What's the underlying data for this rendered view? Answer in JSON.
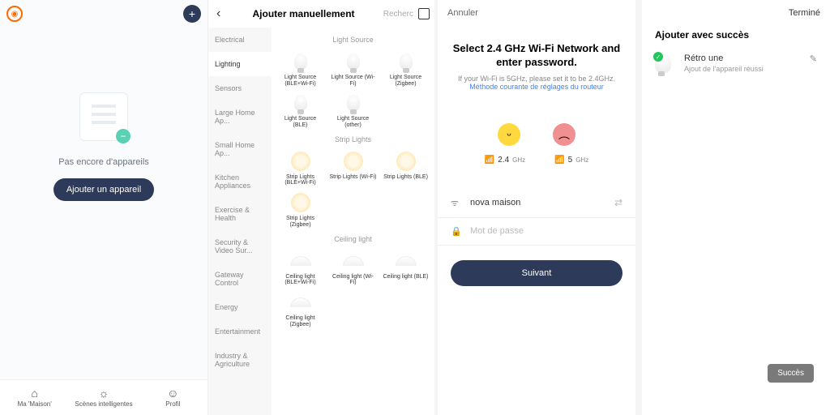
{
  "pane1": {
    "empty_msg": "Pas encore d'appareils",
    "add_btn": "Ajouter un appareil",
    "nav": [
      {
        "icon": "⌂",
        "label": "Ma 'Maison'"
      },
      {
        "icon": "☼",
        "label": "Scènes intelligentes"
      },
      {
        "icon": "☺",
        "label": "Profil"
      }
    ]
  },
  "pane2": {
    "title": "Ajouter manuellement",
    "search_hint": "Recherc",
    "categories": [
      "Electrical",
      "Lighting",
      "Sensors",
      "Large Home Ap...",
      "Small Home Ap...",
      "Kitchen Appliances",
      "Exercise & Health",
      "Security & Video Sur...",
      "Gateway Control",
      "Energy",
      "Entertainment",
      "Industry & Agriculture"
    ],
    "active_category": 1,
    "sections": [
      {
        "title": "Light Source",
        "type": "bulb",
        "items": [
          "Light Source (BLE+Wi-Fi)",
          "Light Source (Wi-Fi)",
          "Light Source (Zigbee)",
          "Light Source (BLE)",
          "Light Source (other)"
        ]
      },
      {
        "title": "Strip Lights",
        "type": "strip",
        "items": [
          "Strip Lights (BLE+Wi-Fi)",
          "Strip Lights (Wi-Fi)",
          "Strip Lights (BLE)",
          "Strip Lights (Zigbee)"
        ]
      },
      {
        "title": "Ceiling light",
        "type": "ceil",
        "items": [
          "Ceiling light (BLE+Wi-Fi)",
          "Ceiling light (Wi-Fi)",
          "Ceiling light (BLE)",
          "Ceiling light (Zigbee)"
        ]
      }
    ]
  },
  "pane3": {
    "cancel": "Annuler",
    "title": "Select 2.4 GHz Wi-Fi Network and enter password.",
    "sub_pre": "If your Wi-Fi is 5GHz, please set it to be 2.4GHz. ",
    "sub_link": "Méthode courante de réglages du routeur",
    "freq24": "2.4",
    "ghz": "GHz",
    "freq5": "5",
    "ssid": "nova maison",
    "pw_placeholder": "Mot de passe",
    "next": "Suivant"
  },
  "pane4": {
    "done": "Terminé",
    "title": "Ajouter avec succès",
    "device": "Rétro une",
    "status": "Ajout de l'appareil réussi",
    "toast": "Succès"
  }
}
